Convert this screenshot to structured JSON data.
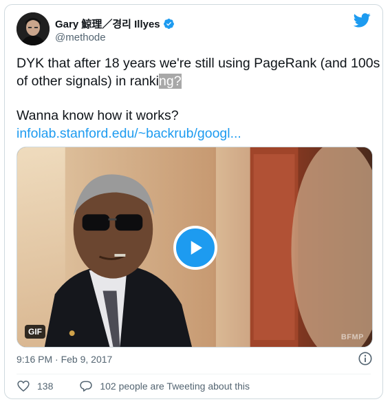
{
  "user": {
    "display_name": "Gary 鯨理／경리 Illyes",
    "handle": "@methode",
    "verified": true
  },
  "tweet": {
    "line1": "DYK that after 18 years we're still using PageRank (and 100s",
    "line2_plain": "of other signals) in ranki",
    "line2_selected": "ng?",
    "line3": "Wanna know how it works?",
    "link": "infolab.stanford.edu/~backrub/googl..."
  },
  "media": {
    "badge": "GIF",
    "watermark": "BFMP"
  },
  "meta": {
    "timestamp": "9:16 PM · Feb 9, 2017"
  },
  "actions": {
    "likes": "138",
    "conversation": "102 people are Tweeting about this"
  },
  "colors": {
    "accent": "#1d9bf0",
    "secondary_text": "#536471",
    "border": "#cfd9de"
  }
}
